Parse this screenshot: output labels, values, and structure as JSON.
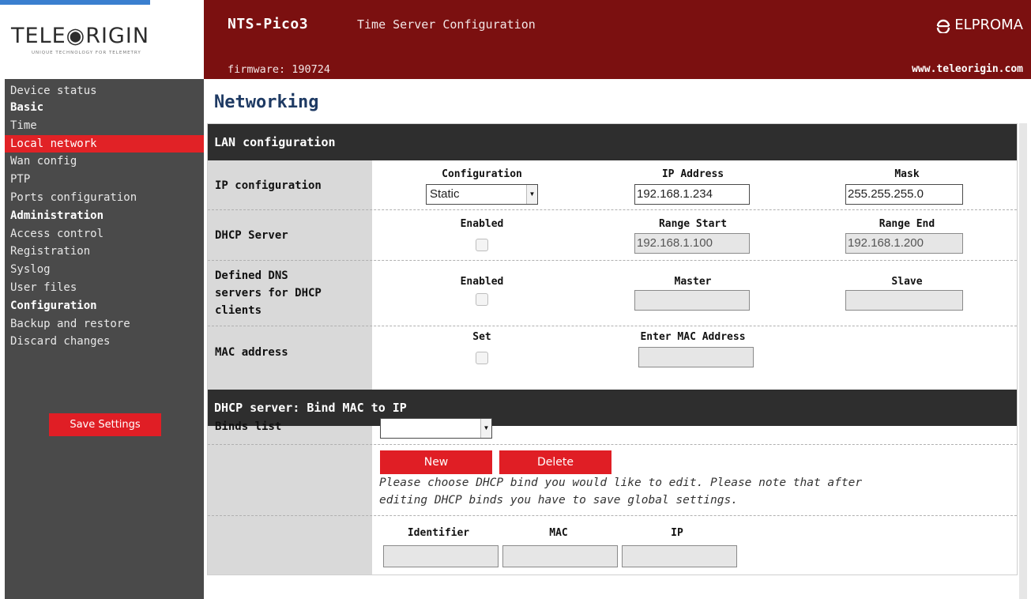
{
  "logo": {
    "wordmark": "TELE◉RIGIN",
    "tagline": "UNIQUE TECHNOLOGY FOR TELEMETRY"
  },
  "header": {
    "product": "NTS-Pico3",
    "subtitle": "Time Server Configuration",
    "brand": "ELPROMA",
    "firmware": "firmware: 190724",
    "url": "www.teleorigin.com"
  },
  "sidebar": {
    "items": [
      {
        "label": "Device status"
      },
      {
        "label": "Basic"
      },
      {
        "label": "Time"
      },
      {
        "label": "Local network"
      },
      {
        "label": "Wan config"
      },
      {
        "label": "PTP"
      },
      {
        "label": "Ports configuration"
      },
      {
        "label": "Administration"
      },
      {
        "label": "Access control"
      },
      {
        "label": "Registration"
      },
      {
        "label": "Syslog"
      },
      {
        "label": "User files"
      },
      {
        "label": "Configuration"
      },
      {
        "label": "Backup and restore"
      },
      {
        "label": "Discard changes"
      }
    ],
    "save_label": "Save Settings"
  },
  "page": {
    "title": "Networking"
  },
  "lan": {
    "section_title": "LAN configuration",
    "ip_config": {
      "label": "IP configuration",
      "config_label": "Configuration",
      "config_value": "Static",
      "ip_label": "IP Address",
      "ip_value": "192.168.1.234",
      "mask_label": "Mask",
      "mask_value": "255.255.255.0"
    },
    "dhcp_server": {
      "label": "DHCP Server",
      "enabled_label": "Enabled",
      "range_start_label": "Range Start",
      "range_start_value": "192.168.1.100",
      "range_end_label": "Range End",
      "range_end_value": "192.168.1.200"
    },
    "dns": {
      "label_line1": "Defined DNS",
      "label_line2": "servers for DHCP",
      "label_line3": "clients",
      "enabled_label": "Enabled",
      "master_label": "Master",
      "master_value": "",
      "slave_label": "Slave",
      "slave_value": ""
    },
    "mac": {
      "label": "MAC address",
      "set_label": "Set",
      "enter_label": "Enter MAC Address",
      "value": ""
    }
  },
  "binds": {
    "section_title": "DHCP server: Bind MAC to IP",
    "list_label": "Binds list",
    "list_value": "",
    "new_label": "New",
    "delete_label": "Delete",
    "note_line1": "Please choose DHCP bind you would like to edit. Please note that after",
    "note_line2": "editing DHCP binds you have to save global settings.",
    "identifier_label": "Identifier",
    "mac_label": "MAC",
    "ip_label": "IP"
  }
}
